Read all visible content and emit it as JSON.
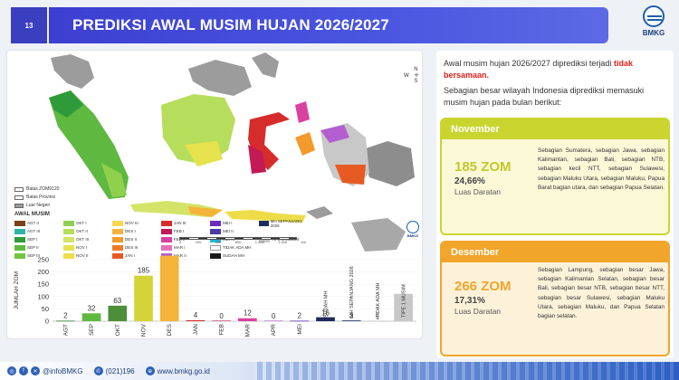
{
  "slide": {
    "number": "13",
    "title": "PREDIKSI AWAL MUSIM HUJAN 2026/2027",
    "logo_text": "BMKG"
  },
  "map": {
    "compass": {
      "n": "N",
      "e": "E",
      "s": "S",
      "w": "W"
    },
    "legend_basic": [
      {
        "label": "Batas ZOM9120",
        "color": "#ffffff"
      },
      {
        "label": "Batas Provinsi",
        "color": "#ffffff"
      },
      {
        "label": "Luar Negeri",
        "color": "#9a9a9a"
      }
    ],
    "legend_title": "AWAL MUSIM",
    "legend_items": [
      {
        "label": "AGT II",
        "color": "#7b3f17"
      },
      {
        "label": "OKT I",
        "color": "#8fd14f"
      },
      {
        "label": "NOV III",
        "color": "#f7d84c"
      },
      {
        "label": "JAN III",
        "color": "#d72c2c"
      },
      {
        "label": "MEI I",
        "color": "#6a2dbd"
      },
      {
        "label": "MH SEPANJANG 2026",
        "color": "#1e2a5a"
      },
      {
        "label": "",
        "color": ""
      },
      {
        "label": "AGT III",
        "color": "#2fb3a3"
      },
      {
        "label": "OKT II",
        "color": "#b6dd5b"
      },
      {
        "label": "DES I",
        "color": "#f4b43a"
      },
      {
        "label": "FEB I",
        "color": "#c21a56"
      },
      {
        "label": "MEI II",
        "color": "#4b3aa8"
      },
      {
        "label": "",
        "color": ""
      },
      {
        "label": "",
        "color": ""
      },
      {
        "label": "SEP I",
        "color": "#2f9a3a"
      },
      {
        "label": "OKT III",
        "color": "#d4e469"
      },
      {
        "label": "DES II",
        "color": "#f29a2b"
      },
      {
        "label": "FEB II",
        "color": "#d940a0"
      },
      {
        "label": "MEI III",
        "color": "#22b8d9"
      },
      {
        "label": "TIPE 1 MUSIM",
        "color": "#c8c8c8"
      },
      {
        "label": "",
        "color": ""
      },
      {
        "label": "SEP II",
        "color": "#5fb840"
      },
      {
        "label": "NOV I",
        "color": "#e6e24e"
      },
      {
        "label": "DES III",
        "color": "#ef7a26"
      },
      {
        "label": "MAR I",
        "color": "#e86fb8"
      },
      {
        "label": "TIDAK ADA MH",
        "color": "#ffffff"
      },
      {
        "label": "",
        "color": ""
      },
      {
        "label": "",
        "color": ""
      },
      {
        "label": "SEP III",
        "color": "#74c43f"
      },
      {
        "label": "NOV II",
        "color": "#eedd49"
      },
      {
        "label": "JAN I",
        "color": "#e85a23"
      },
      {
        "label": "MAR II",
        "color": "#b45fd1"
      },
      {
        "label": "SUDAH MH",
        "color": "#1a1a1a"
      },
      {
        "label": "",
        "color": ""
      },
      {
        "label": "",
        "color": ""
      }
    ],
    "scale_labels": [
      "0",
      "200",
      "400",
      "800",
      "1.200",
      "1.600",
      "km"
    ],
    "mini_logo": "BMKG"
  },
  "chart_data": {
    "type": "bar",
    "ylabel": "JUMLAH ZOM",
    "ylim": [
      0,
      250
    ],
    "yticks": [
      0,
      50,
      100,
      150,
      200,
      250
    ],
    "categories": [
      "AGT",
      "SEP",
      "OKT",
      "NOV",
      "DES",
      "JAN",
      "FEB",
      "MAR",
      "APR",
      "MEI",
      "SUDAH MH",
      "MH SEPANJANG 2026",
      "TIDAK ADA MH",
      "TIPE 1 MUSIM"
    ],
    "values": [
      2,
      32,
      63,
      185,
      266,
      4,
      0,
      12,
      0,
      2,
      16,
      3,
      1,
      111
    ],
    "labels": [
      "2",
      "32",
      "63",
      "185",
      "266",
      "4",
      "0",
      "12",
      "0",
      "2",
      "16",
      "3",
      "1",
      ""
    ],
    "colors": [
      "#2f7b36",
      "#5fb840",
      "#4b8f3a",
      "#d4d43a",
      "#f4b43a",
      "#d72c2c",
      "#c21a56",
      "#d940a0",
      "#b45fd1",
      "#6a2dbd",
      "#1e2a5a",
      "#1e2a5a",
      "#ffffff",
      "#c8c8c8"
    ]
  },
  "right": {
    "intro_prefix": "Awal musim hujan 2026/2027 diprediksi terjadi ",
    "intro_red": "tidak bersamaan.",
    "intro2": "Sebagian besar wilayah Indonesia diprediksi memasuki musim hujan pada bulan berikut:",
    "cards": [
      {
        "month": "November",
        "zom": "185 ZOM",
        "pct": "24,66%",
        "luas": "Luas Daratan",
        "desc": "Sebagian Sumatera, sebagian Jawa, sebagian Kalimantan, sebagian Bali, sebagian NTB, sebagian kecil NTT, sebagian Sulawesi, sebagian Maluku Utara, sebagian Maluku, Papua Barat bagian utara, dan sebagian Papua Selatan."
      },
      {
        "month": "Desember",
        "zom": "266 ZOM",
        "pct": "17,31%",
        "luas": "Luas Daratan",
        "desc": "Sebagian Lampung, sebagian besar Jawa, sebagian Kalimantan Selatan, sebagian besar Bali, sebagian besar NTB, sebagian besar NTT, sebagian besar Sulawesi, sebagian Maluku Utara, sebagian Maluku, dan Papua Selatan bagian selatan."
      }
    ]
  },
  "footer": {
    "social_handle": "@infoBMKG",
    "phone": "(021)196",
    "website": "www.bmkg.go.id"
  }
}
